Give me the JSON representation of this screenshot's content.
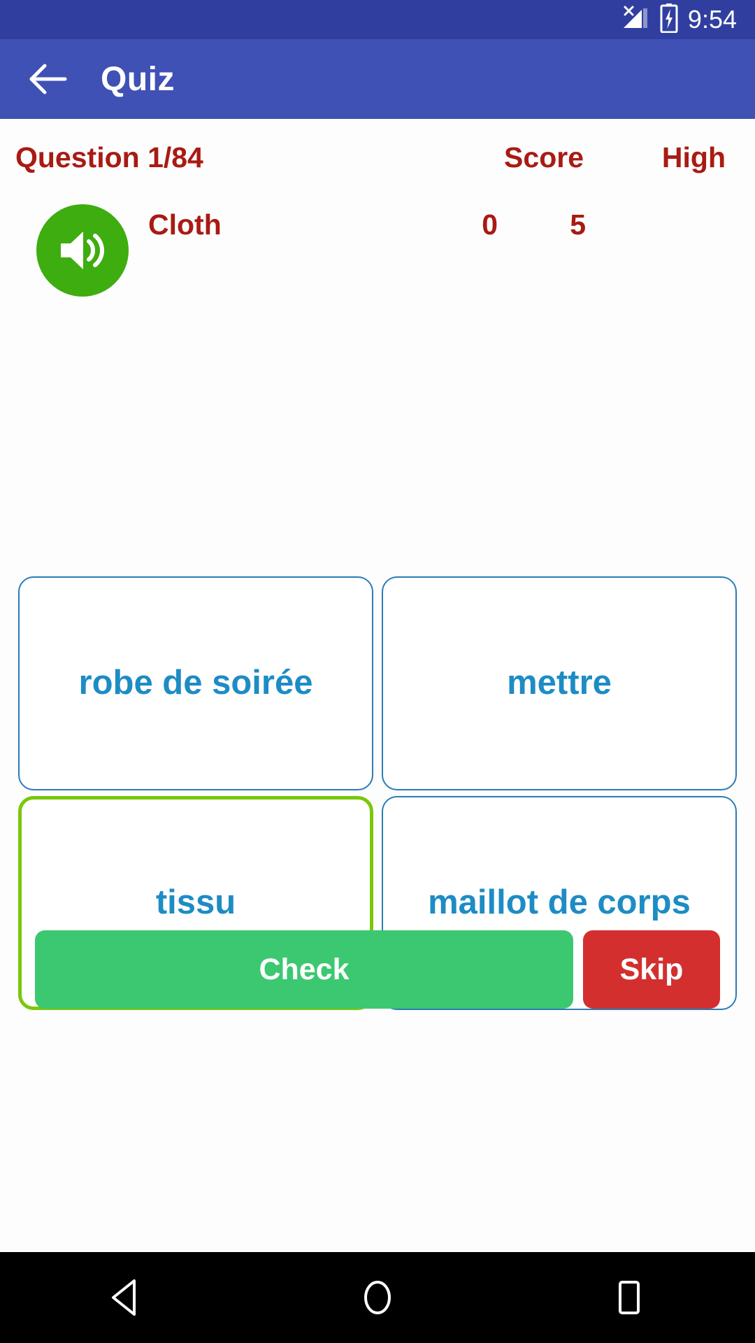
{
  "statusbar": {
    "time": "9:54",
    "signal_icon": "signal-no-service-icon",
    "battery_icon": "battery-charging-icon"
  },
  "appbar": {
    "back_icon": "back-arrow-icon",
    "title": "Quiz",
    "background": "#3f51b5"
  },
  "quiz": {
    "question_label": "Question 1/84",
    "score_label": "Score",
    "high_label": "High",
    "score_value": "0",
    "high_value": "5",
    "word": "Cloth",
    "speaker_icon": "speaker-volume-icon",
    "accent_red": "#a81b13",
    "speaker_green": "#3dad10"
  },
  "answers": [
    {
      "label": "robe de soirée",
      "selected": false
    },
    {
      "label": "mettre",
      "selected": false
    },
    {
      "label": "tissu",
      "selected": true
    },
    {
      "label": "maillot de corps",
      "selected": false
    }
  ],
  "answer_colors": {
    "text": "#1e8cc4",
    "border": "#2b7cb5",
    "selected_border": "#7ac70c"
  },
  "actions": {
    "check_label": "Check",
    "skip_label": "Skip",
    "check_color": "#3cc871",
    "skip_color": "#d32f2f"
  },
  "navbar": {
    "back_icon": "nav-back-triangle-icon",
    "home_icon": "nav-home-circle-icon",
    "recents_icon": "nav-recents-square-icon"
  }
}
